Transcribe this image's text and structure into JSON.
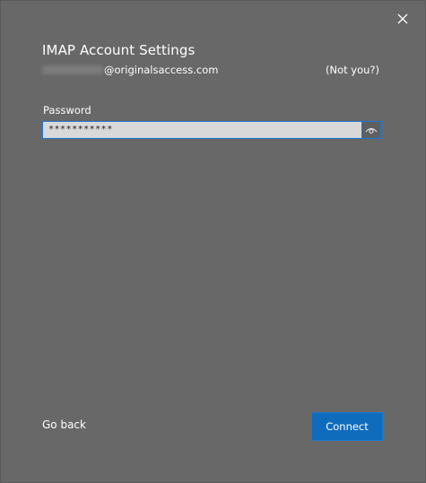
{
  "dialog": {
    "title": "IMAP Account Settings",
    "close_icon": "close-icon"
  },
  "account": {
    "email_domain": "@originalsaccess.com",
    "not_you_label": "(Not you?)"
  },
  "password": {
    "label": "Password",
    "value": "***********",
    "reveal_icon": "eye-icon"
  },
  "footer": {
    "go_back_label": "Go back",
    "connect_label": "Connect"
  },
  "colors": {
    "background": "#686868",
    "input_bg": "#d9d9d9",
    "accent": "#0f6cbd",
    "focus_border": "#1e78d2"
  }
}
